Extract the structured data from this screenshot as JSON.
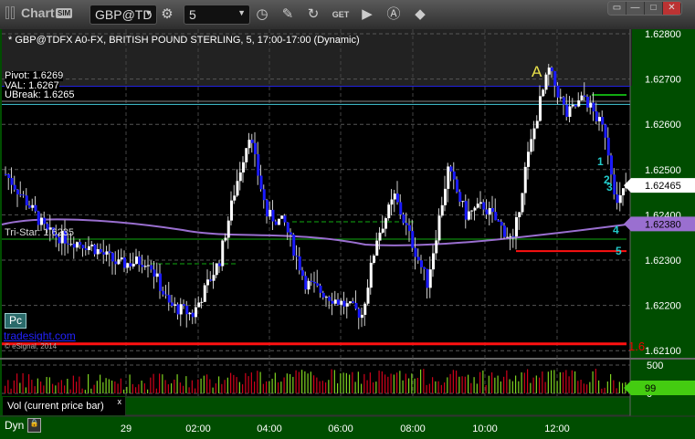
{
  "window": {
    "title": "Chart",
    "sim_badge": "SIM",
    "symbol": "GBP@TD",
    "interval": "5",
    "tool_icons": [
      "gear-icon",
      "clock-icon",
      "pencil-icon",
      "study-icon",
      "get-icon",
      "play-icon",
      "alert-icon",
      "link-icon"
    ],
    "controls": [
      "restore-icon",
      "minimize-icon",
      "maximize-icon",
      "close-icon"
    ]
  },
  "chart": {
    "header": "* GBP@TDFX A0-FX, BRITISH POUND STERLING, 5, 17:00-17:00 (Dynamic)",
    "labels": {
      "pivot": "Pivot: 1.6269",
      "val": "VAL: 1.6267",
      "ubreak": "UBreak: 1.6265",
      "tristar": "Tri-Star: 1.6235",
      "a_marker": "A",
      "red_level": "1.6"
    },
    "price_ticks": [
      "1.62800",
      "1.62700",
      "1.62600",
      "1.62500",
      "1.62400",
      "1.62300",
      "1.62200",
      "1.62100"
    ],
    "last_price": "1.62465",
    "ma_price": "1.62380",
    "count_labels": [
      "1",
      "2",
      "3",
      "4",
      "5"
    ],
    "pc_button": "Pc",
    "brand_link": "tradesight.com",
    "copyright": "© eSignal, 2014",
    "time_ticks": [
      "29",
      "02:00",
      "04:00",
      "06:00",
      "08:00",
      "10:00",
      "12:00"
    ],
    "colors": {
      "up": "#ffffff",
      "down": "#1a1aff",
      "ma": "#9a6fd0",
      "axis": "#004d00",
      "vol_up": "#7ed321",
      "vol_down": "#d0021b"
    }
  },
  "volume": {
    "label": "Vol (current price bar)",
    "close": "x",
    "ticks": [
      "500",
      "0"
    ],
    "current": "99"
  },
  "footer": {
    "dyn": "Dyn"
  },
  "chart_data": {
    "type": "candlestick",
    "ylim": [
      1.621,
      1.628
    ],
    "waypoints": [
      [
        0,
        1.6249
      ],
      [
        8,
        1.6242
      ],
      [
        14,
        1.6236
      ],
      [
        29,
        1.6233
      ],
      [
        38,
        1.6229
      ],
      [
        48,
        1.623
      ],
      [
        55,
        1.622
      ],
      [
        63,
        1.6218
      ],
      [
        72,
        1.623
      ],
      [
        77,
        1.6245
      ],
      [
        82,
        1.6258
      ],
      [
        88,
        1.624
      ],
      [
        94,
        1.6238
      ],
      [
        101,
        1.6225
      ],
      [
        109,
        1.6222
      ],
      [
        120,
        1.6218
      ],
      [
        125,
        1.6235
      ],
      [
        131,
        1.6244
      ],
      [
        142,
        1.6225
      ],
      [
        149,
        1.625
      ],
      [
        155,
        1.624
      ],
      [
        161,
        1.6242
      ],
      [
        171,
        1.6234
      ],
      [
        175,
        1.625
      ],
      [
        180,
        1.6265
      ],
      [
        183,
        1.6272
      ],
      [
        189,
        1.6262
      ],
      [
        195,
        1.6266
      ],
      [
        202,
        1.6258
      ],
      [
        206,
        1.6242
      ],
      [
        209,
        1.62465
      ]
    ],
    "levels": {
      "pivot": 1.6269,
      "ubreak": 1.6265,
      "val": 1.6267,
      "red": 1.62115,
      "red_short": 1.6232
    }
  }
}
